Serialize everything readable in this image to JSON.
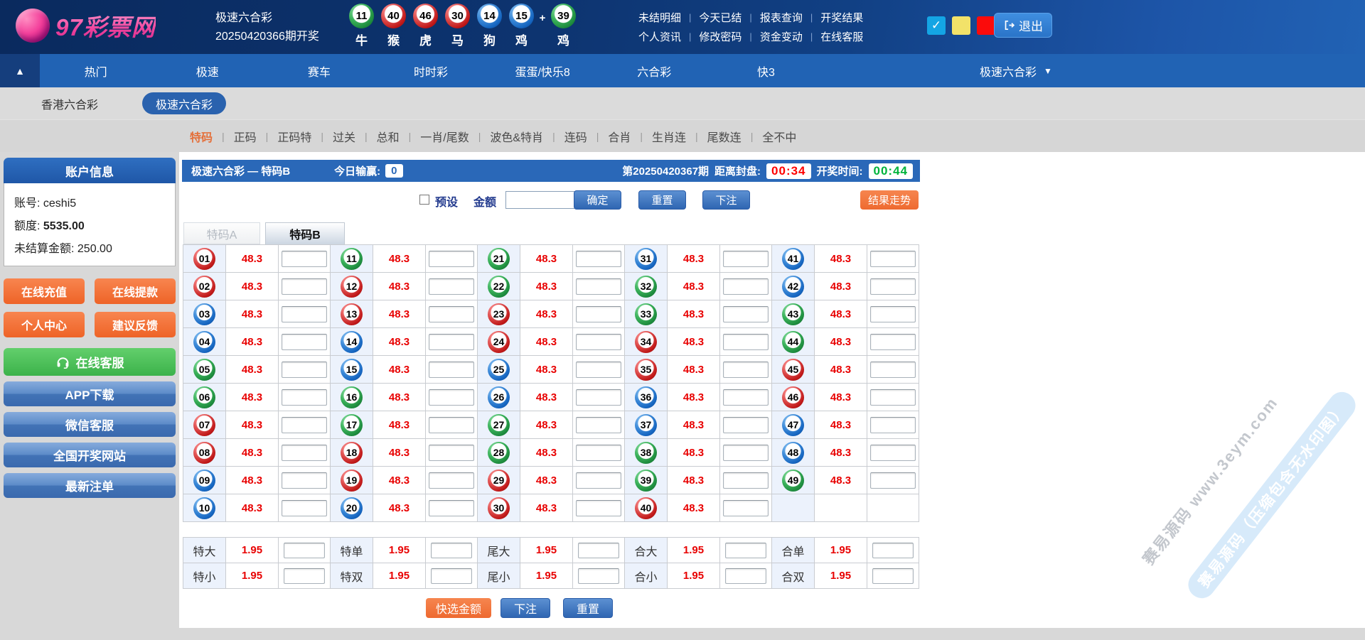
{
  "brand": {
    "logo_text": "97彩票网"
  },
  "header": {
    "lottery_name": "极速六合彩",
    "last_draw": "20250420366期开奖",
    "balls": [
      {
        "num": "11",
        "color": "green",
        "zodiac": "牛"
      },
      {
        "num": "40",
        "color": "red",
        "zodiac": "猴"
      },
      {
        "num": "46",
        "color": "red",
        "zodiac": "虎"
      },
      {
        "num": "30",
        "color": "red",
        "zodiac": "马"
      },
      {
        "num": "14",
        "color": "blue",
        "zodiac": "狗"
      },
      {
        "num": "15",
        "color": "blue",
        "zodiac": "鸡"
      },
      {
        "num": "39",
        "color": "green",
        "zodiac": "鸡",
        "plus_before": true
      }
    ],
    "menu_row1": [
      "未结明细",
      "今天已结",
      "报表查询",
      "开奖结果"
    ],
    "menu_row2": [
      "个人资讯",
      "修改密码",
      "资金变动",
      "在线客服"
    ],
    "swatches": [
      {
        "name": "blue",
        "color": "#14a5e4",
        "checked": true
      },
      {
        "name": "yellow",
        "color": "#f2e269",
        "checked": false
      },
      {
        "name": "red",
        "color": "#fb0b0b",
        "checked": false
      }
    ],
    "logout_label": "退出"
  },
  "nav": {
    "collapse_icon": "▲",
    "items": [
      "热门",
      "极速",
      "赛车",
      "时时彩",
      "蛋蛋/快乐8",
      "六合彩",
      "快3"
    ],
    "selector_label": "极速六合彩",
    "selector_arrow": "▼"
  },
  "subnav": {
    "items": [
      {
        "label": "香港六合彩",
        "active": false
      },
      {
        "label": "极速六合彩",
        "active": true
      }
    ]
  },
  "bet_tabs": {
    "items": [
      "特码",
      "正码",
      "正码特",
      "过关",
      "总和",
      "一肖/尾数",
      "波色&特肖",
      "连码",
      "合肖",
      "生肖连",
      "尾数连",
      "全不中"
    ],
    "active_index": 0
  },
  "sidebar": {
    "account_title": "账户信息",
    "account_label": "账号:",
    "account_value": "ceshi5",
    "balance_label": "额度:",
    "balance_value": "5535.00",
    "unsettled_label": "未结算金额:",
    "unsettled_value": "250.00",
    "quick_buttons": [
      "在线充值",
      "在线提款",
      "个人中心",
      "建议反馈"
    ],
    "service_button": "在线客服",
    "link_buttons": [
      "APP下载",
      "微信客服",
      "全国开奖网站",
      "最新注单"
    ]
  },
  "main": {
    "panel_title": "极速六合彩 — 特码B",
    "today_label": "今日输赢:",
    "today_value": "0",
    "period": "第20250420367期",
    "close_label": "距离封盘:",
    "close_time": "00:34",
    "open_label": "开奖时间:",
    "open_time": "00:44",
    "preset_label": "预设",
    "amount_label": "金额",
    "confirm_label": "确定",
    "reset_label": "重置",
    "bet_label": "下注",
    "trend_label": "结果走势",
    "tabs": [
      {
        "label": "特码A",
        "active": false
      },
      {
        "label": "特码B",
        "active": true
      }
    ],
    "quick_amount_label": "快选金额",
    "bottom_bet_label": "下注",
    "bottom_reset_label": "重置"
  },
  "numbers": [
    {
      "n": "01",
      "c": "red",
      "odds": "48.3"
    },
    {
      "n": "02",
      "c": "red",
      "odds": "48.3"
    },
    {
      "n": "03",
      "c": "blue",
      "odds": "48.3"
    },
    {
      "n": "04",
      "c": "blue",
      "odds": "48.3"
    },
    {
      "n": "05",
      "c": "green",
      "odds": "48.3"
    },
    {
      "n": "06",
      "c": "green",
      "odds": "48.3"
    },
    {
      "n": "07",
      "c": "red",
      "odds": "48.3"
    },
    {
      "n": "08",
      "c": "red",
      "odds": "48.3"
    },
    {
      "n": "09",
      "c": "blue",
      "odds": "48.3"
    },
    {
      "n": "10",
      "c": "blue",
      "odds": "48.3"
    },
    {
      "n": "11",
      "c": "green",
      "odds": "48.3"
    },
    {
      "n": "12",
      "c": "red",
      "odds": "48.3"
    },
    {
      "n": "13",
      "c": "red",
      "odds": "48.3"
    },
    {
      "n": "14",
      "c": "blue",
      "odds": "48.3"
    },
    {
      "n": "15",
      "c": "blue",
      "odds": "48.3"
    },
    {
      "n": "16",
      "c": "green",
      "odds": "48.3"
    },
    {
      "n": "17",
      "c": "green",
      "odds": "48.3"
    },
    {
      "n": "18",
      "c": "red",
      "odds": "48.3"
    },
    {
      "n": "19",
      "c": "red",
      "odds": "48.3"
    },
    {
      "n": "20",
      "c": "blue",
      "odds": "48.3"
    },
    {
      "n": "21",
      "c": "green",
      "odds": "48.3"
    },
    {
      "n": "22",
      "c": "green",
      "odds": "48.3"
    },
    {
      "n": "23",
      "c": "red",
      "odds": "48.3"
    },
    {
      "n": "24",
      "c": "red",
      "odds": "48.3"
    },
    {
      "n": "25",
      "c": "blue",
      "odds": "48.3"
    },
    {
      "n": "26",
      "c": "blue",
      "odds": "48.3"
    },
    {
      "n": "27",
      "c": "green",
      "odds": "48.3"
    },
    {
      "n": "28",
      "c": "green",
      "odds": "48.3"
    },
    {
      "n": "29",
      "c": "red",
      "odds": "48.3"
    },
    {
      "n": "30",
      "c": "red",
      "odds": "48.3"
    },
    {
      "n": "31",
      "c": "blue",
      "odds": "48.3"
    },
    {
      "n": "32",
      "c": "green",
      "odds": "48.3"
    },
    {
      "n": "33",
      "c": "green",
      "odds": "48.3"
    },
    {
      "n": "34",
      "c": "red",
      "odds": "48.3"
    },
    {
      "n": "35",
      "c": "red",
      "odds": "48.3"
    },
    {
      "n": "36",
      "c": "blue",
      "odds": "48.3"
    },
    {
      "n": "37",
      "c": "blue",
      "odds": "48.3"
    },
    {
      "n": "38",
      "c": "green",
      "odds": "48.3"
    },
    {
      "n": "39",
      "c": "green",
      "odds": "48.3"
    },
    {
      "n": "40",
      "c": "red",
      "odds": "48.3"
    },
    {
      "n": "41",
      "c": "blue",
      "odds": "48.3"
    },
    {
      "n": "42",
      "c": "blue",
      "odds": "48.3"
    },
    {
      "n": "43",
      "c": "green",
      "odds": "48.3"
    },
    {
      "n": "44",
      "c": "green",
      "odds": "48.3"
    },
    {
      "n": "45",
      "c": "red",
      "odds": "48.3"
    },
    {
      "n": "46",
      "c": "red",
      "odds": "48.3"
    },
    {
      "n": "47",
      "c": "blue",
      "odds": "48.3"
    },
    {
      "n": "48",
      "c": "blue",
      "odds": "48.3"
    },
    {
      "n": "49",
      "c": "green",
      "odds": "48.3"
    }
  ],
  "bottom_rows": [
    [
      {
        "label": "特大",
        "odds": "1.95"
      },
      {
        "label": "特单",
        "odds": "1.95"
      },
      {
        "label": "尾大",
        "odds": "1.95"
      },
      {
        "label": "合大",
        "odds": "1.95"
      },
      {
        "label": "合单",
        "odds": "1.95"
      }
    ],
    [
      {
        "label": "特小",
        "odds": "1.95"
      },
      {
        "label": "特双",
        "odds": "1.95"
      },
      {
        "label": "尾小",
        "odds": "1.95"
      },
      {
        "label": "合小",
        "odds": "1.95"
      },
      {
        "label": "合双",
        "odds": "1.95"
      }
    ]
  ],
  "watermark": {
    "line1": "赛易源码 www.3eym.com",
    "line2": "赛易源码（压缩包含无水印图）"
  }
}
